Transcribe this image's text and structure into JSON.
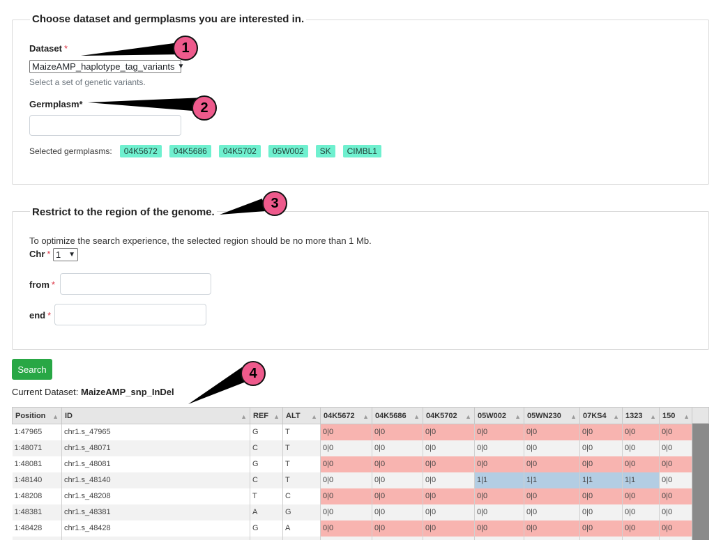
{
  "section1": {
    "title": "Choose dataset and germplasms you are interested in.",
    "dataset_label": "Dataset",
    "required_mark": "*",
    "dataset_value": "MaizeAMP_haplotype_tag_variants",
    "dataset_help": "Select a set of genetic variants.",
    "germplasm_label": "Germplasm*",
    "germplasm_value": "",
    "selected_label": "Selected germplasms:",
    "selected": [
      "04K5672",
      "04K5686",
      "04K5702",
      "05W002",
      "SK",
      "CIMBL1"
    ]
  },
  "section2": {
    "title": "Restrict to the region of the genome.",
    "note": "To optimize the search experience, the selected region should be no more than 1 Mb.",
    "chr_label": "Chr",
    "chr_value": "1",
    "from_label": "from",
    "from_value": "",
    "end_label": "end",
    "end_value": ""
  },
  "search_button": "Search",
  "current_dataset_label": "Current Dataset:",
  "current_dataset_value": "MaizeAMP_snp_InDel",
  "markers": [
    "1",
    "2",
    "3",
    "4"
  ],
  "colors": {
    "chip": "#6ff0cf",
    "search": "#28a745",
    "ref_cell": "#f8b4b0",
    "alt_cell": "#b3cde3",
    "marker": "#ee5a8c"
  },
  "table": {
    "sort_icon": "sort-up-icon",
    "columns": [
      "Position",
      "ID",
      "REF",
      "ALT",
      "04K5672",
      "04K5686",
      "04K5702",
      "05W002",
      "05WN230",
      "07KS4",
      "1323",
      "150"
    ],
    "rows": [
      [
        "1:47965",
        "chr1.s_47965",
        "G",
        "T",
        "0|0",
        "0|0",
        "0|0",
        "0|0",
        "0|0",
        "0|0",
        "0|0",
        "0|0"
      ],
      [
        "1:48071",
        "chr1.s_48071",
        "C",
        "T",
        "0|0",
        "0|0",
        "0|0",
        "0|0",
        "0|0",
        "0|0",
        "0|0",
        "0|0"
      ],
      [
        "1:48081",
        "chr1.s_48081",
        "G",
        "T",
        "0|0",
        "0|0",
        "0|0",
        "0|0",
        "0|0",
        "0|0",
        "0|0",
        "0|0"
      ],
      [
        "1:48140",
        "chr1.s_48140",
        "C",
        "T",
        "0|0",
        "0|0",
        "0|0",
        "1|1",
        "1|1",
        "1|1",
        "1|1",
        "0|0"
      ],
      [
        "1:48208",
        "chr1.s_48208",
        "T",
        "C",
        "0|0",
        "0|0",
        "0|0",
        "0|0",
        "0|0",
        "0|0",
        "0|0",
        "0|0"
      ],
      [
        "1:48381",
        "chr1.s_48381",
        "A",
        "G",
        "0|0",
        "0|0",
        "0|0",
        "0|0",
        "0|0",
        "0|0",
        "0|0",
        "0|0"
      ],
      [
        "1:48428",
        "chr1.s_48428",
        "G",
        "A",
        "0|0",
        "0|0",
        "0|0",
        "0|0",
        "0|0",
        "0|0",
        "0|0",
        "0|0"
      ],
      [
        "",
        "",
        "",
        "",
        "",
        "",
        "",
        "",
        "",
        "",
        "",
        ""
      ]
    ]
  }
}
